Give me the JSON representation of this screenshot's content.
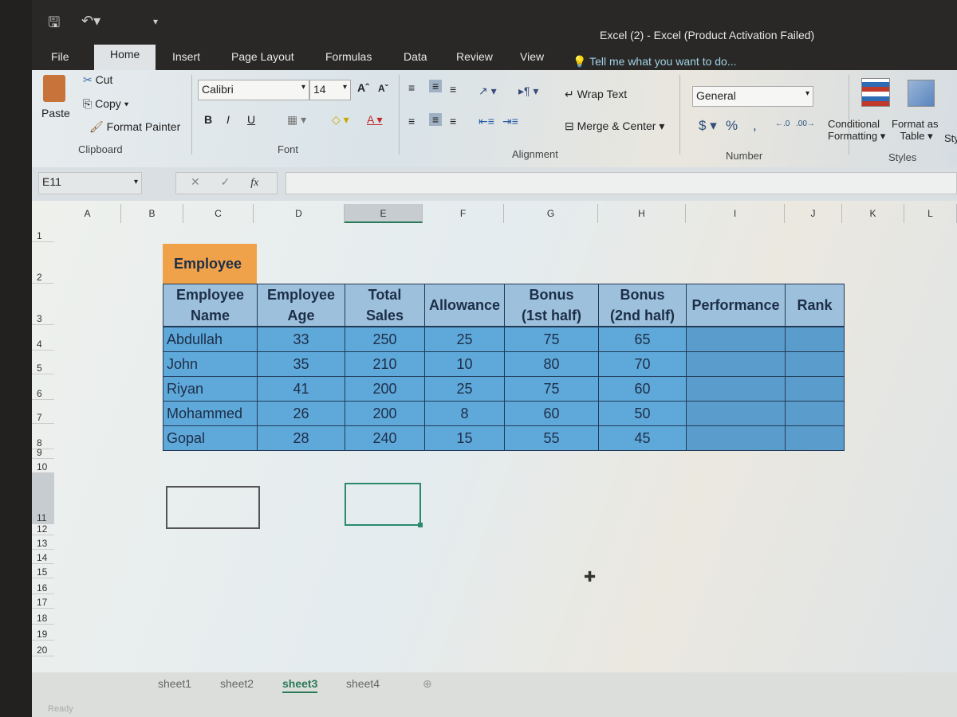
{
  "window": {
    "title": "Excel (2) - Excel (Product Activation Failed)"
  },
  "qat": {
    "save_icon": "save-icon",
    "undo_icon": "undo-icon",
    "customize_icon": "customize-qat-icon"
  },
  "tabs": [
    {
      "label": "File"
    },
    {
      "label": "Home",
      "active": true
    },
    {
      "label": "Insert"
    },
    {
      "label": "Page Layout"
    },
    {
      "label": "Formulas"
    },
    {
      "label": "Data"
    },
    {
      "label": "Review"
    },
    {
      "label": "View"
    }
  ],
  "tell_me": "Tell me what you want to do...",
  "ribbon": {
    "clipboard": {
      "paste": "Paste",
      "cut": "Cut",
      "copy": "Copy",
      "format_painter": "Format Painter",
      "group": "Clipboard"
    },
    "font": {
      "name": "Calibri",
      "size": "14",
      "bold": "B",
      "italic": "I",
      "underline": "U",
      "group": "Font"
    },
    "alignment": {
      "wrap": "Wrap Text",
      "merge": "Merge & Center",
      "group": "Alignment"
    },
    "number": {
      "format": "General",
      "currency": "$",
      "percent": "%",
      "comma": ",",
      "group": "Number"
    },
    "styles": {
      "conditional": "Conditional",
      "conditional2": "Formatting",
      "format_table": "Format as",
      "format_table2": "Table",
      "cell_styles": "Sty",
      "group": "Styles"
    }
  },
  "formula_bar": {
    "name_box": "E11",
    "cancel": "✕",
    "enter": "✓",
    "fx": "fx",
    "value": ""
  },
  "columns": [
    "A",
    "B",
    "C",
    "D",
    "E",
    "F",
    "G",
    "H",
    "I",
    "J",
    "K",
    "L"
  ],
  "rows": [
    "1",
    "2",
    "3",
    "4",
    "5",
    "6",
    "7",
    "8",
    "9",
    "10",
    "11",
    "12",
    "13",
    "14",
    "15",
    "16",
    "17",
    "18",
    "19",
    "20"
  ],
  "sheet": {
    "title_cell": "Employee",
    "headers": [
      "Employee Name",
      "Employee Age",
      "Total Sales",
      "Allowance",
      "Bonus (1st half)",
      "Bonus (2nd half)",
      "Performance",
      "Rank"
    ],
    "header_lines": [
      [
        "Employee",
        "Name"
      ],
      [
        "Employee",
        "Age"
      ],
      [
        "Total",
        "Sales"
      ],
      [
        "Allowance"
      ],
      [
        "Bonus",
        "(1st half)"
      ],
      [
        "Bonus",
        "(2nd half)"
      ],
      [
        "Performance"
      ],
      [
        "Rank"
      ]
    ],
    "rows": [
      [
        "Abdullah",
        "33",
        "250",
        "25",
        "75",
        "65",
        "",
        ""
      ],
      [
        "John",
        "35",
        "210",
        "10",
        "80",
        "70",
        "",
        ""
      ],
      [
        "Riyan",
        "41",
        "200",
        "25",
        "75",
        "60",
        "",
        ""
      ],
      [
        "Mohammed",
        "26",
        "200",
        "8",
        "60",
        "50",
        "",
        ""
      ],
      [
        "Gopal",
        "28",
        "240",
        "15",
        "55",
        "45",
        "",
        ""
      ]
    ],
    "colors": {
      "title_fill": "#f0a24a",
      "header_fill": "#9dc0dc",
      "data_fill": "#5fa8da",
      "border": "#233a55"
    }
  },
  "selected_cell": "E11",
  "sheet_tabs": [
    {
      "label": "sheet1"
    },
    {
      "label": "sheet2"
    },
    {
      "label": "sheet3",
      "active": true
    },
    {
      "label": "sheet4"
    }
  ],
  "status": "Ready"
}
